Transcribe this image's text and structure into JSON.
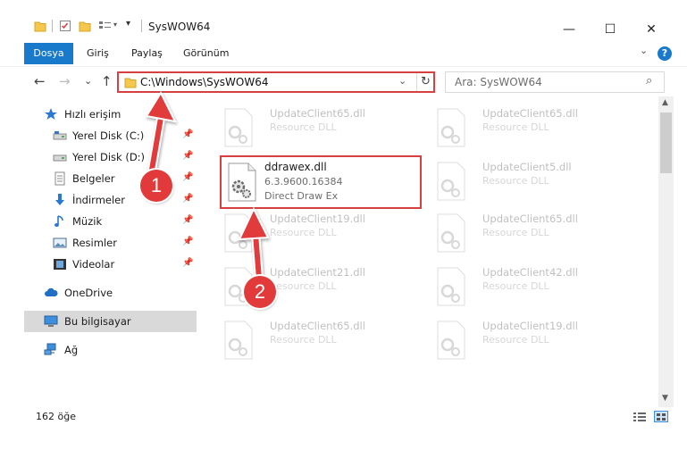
{
  "window": {
    "title": "SysWOW64",
    "minimize_glyph": "—",
    "maximize_glyph": "☐",
    "close_glyph": "✕"
  },
  "ribbon": {
    "tabs": [
      "Dosya",
      "Giriş",
      "Paylaş",
      "Görünüm"
    ],
    "help_glyph": "?"
  },
  "navigation": {
    "back_glyph": "←",
    "forward_glyph": "→",
    "recent_glyph": "⌄",
    "up_glyph": "↑",
    "address": "C:\\Windows\\SysWOW64",
    "refresh_glyph": "↻",
    "search_placeholder": "Ara: SysWOW64"
  },
  "sidebar": {
    "items": [
      {
        "label": "Hızlı erişim",
        "icon": "star-icon",
        "pinned": false
      },
      {
        "label": "Yerel Disk (C:)",
        "icon": "drive-icon",
        "pinned": true
      },
      {
        "label": "Yerel Disk (D:)",
        "icon": "drive-icon",
        "pinned": true
      },
      {
        "label": "Belgeler",
        "icon": "document-icon",
        "pinned": true
      },
      {
        "label": "İndirmeler",
        "icon": "download-icon",
        "pinned": true
      },
      {
        "label": "Müzik",
        "icon": "music-icon",
        "pinned": true
      },
      {
        "label": "Resimler",
        "icon": "picture-icon",
        "pinned": true
      },
      {
        "label": "Videolar",
        "icon": "video-icon",
        "pinned": true
      },
      {
        "label": "OneDrive",
        "icon": "cloud-icon",
        "pinned": false
      },
      {
        "label": "Bu bilgisayar",
        "icon": "computer-icon",
        "pinned": false,
        "selected": true
      },
      {
        "label": "Ağ",
        "icon": "network-icon",
        "pinned": false
      }
    ]
  },
  "files": {
    "highlighted": {
      "name": "ddrawex.dll",
      "version": "6.3.9600.16384",
      "description": "Direct Draw Ex"
    },
    "faded": [
      {
        "name": "UpdateClient65.dll",
        "type": "Resource DLL"
      },
      {
        "name": "UpdateClient65.dll",
        "type": "Resource DLL"
      },
      {
        "name": "UpdateClient5.dll",
        "type": "Resource DLL"
      },
      {
        "name": "UpdateClient19.dll",
        "type": "Resource DLL"
      },
      {
        "name": "UpdateClient65.dll",
        "type": "Resource DLL"
      },
      {
        "name": "UpdateClient21.dll",
        "type": "Resource DLL"
      },
      {
        "name": "UpdateClient42.dll",
        "type": "Resource DLL"
      },
      {
        "name": "UpdateClient65.dll",
        "type": "Resource DLL"
      },
      {
        "name": "UpdateClient19.dll",
        "type": "Resource DLL"
      }
    ]
  },
  "status": {
    "item_count": "162 öğe"
  },
  "callouts": {
    "step1": "1",
    "step2": "2"
  },
  "colors": {
    "accent": "#1979ca",
    "highlight_red": "#d64040",
    "callout_red": "#e23a3a"
  }
}
